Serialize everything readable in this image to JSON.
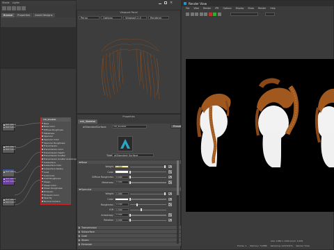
{
  "maya": {
    "top_menu": [
      "Shade",
      "Lights"
    ],
    "tabs": [
      "Browse",
      "Properties",
      "Asset Designs"
    ],
    "viewport_title": "Viewport Panel",
    "viewport_dropdowns": [
      "Persp",
      "Options",
      "Viewport 2.0",
      "Renderer"
    ],
    "hypershade_title": "Hypershade"
  },
  "nodes": [
    {
      "title": "aiStandardHair",
      "ports": [
        "Out Value",
        "Out Color"
      ]
    },
    {
      "title": "aiStandardHair",
      "ports": [
        "Out Value",
        "Out Color"
      ]
    },
    {
      "title": "aiStandardHair",
      "ports": [
        "Out Value",
        "Out Color"
      ]
    },
    {
      "title": "aiStandardHair",
      "ports": [
        "Out Value",
        "Out Color"
      ]
    },
    {
      "title": "aiStandardHair",
      "ports": [
        "Out Value",
        "Out Color"
      ]
    }
  ],
  "main_node": {
    "title": "mtl_Skeletal",
    "ports": [
      "Base",
      "Base Color",
      "Diffuse Roughness",
      "Metalness",
      "Specular",
      "Specular Color",
      "Specular Roughness",
      "Transmission",
      "Transmission Color",
      "Transmission Depth",
      "Transmission Scatter",
      "Transmission Scatter Anisotropy",
      "Subsurface",
      "Subsurface Color",
      "Subsurface Radius",
      "Coat",
      "Coat Color",
      "Coat Roughness",
      "Sheen",
      "Sheen Color",
      "Sheen Roughness",
      "Emission",
      "Emission Color",
      "Opacity",
      "Normal Camera"
    ]
  },
  "attribute_editor": {
    "title": "Properties",
    "tab": "mtl_Skeletal",
    "type_label": "aiStandardSurface:",
    "name_value": "mtl_Skeletal",
    "preset_label": "Presets*",
    "material_type_label": "Type",
    "material_type_value": "aiStandard Surface",
    "sections": {
      "base": "Base",
      "specular": "Specular",
      "transmission": "Transmission",
      "subsurface": "Subsurface",
      "coat": "Coat",
      "sheen": "Sheen",
      "emission": "Emission"
    },
    "base_rows": [
      {
        "label": "Weight",
        "value": "1.000",
        "fill": 0.97,
        "map": true
      },
      {
        "label": "Color",
        "value": "",
        "fill": 0.0,
        "swatch": "#ffffff",
        "map": true
      },
      {
        "label": "Diffuse Roughness",
        "value": "0.000",
        "fill": 0.0,
        "map": true
      },
      {
        "label": "Metalness",
        "value": "0.000",
        "fill": 0.0,
        "map": true
      }
    ],
    "specular_rows": [
      {
        "label": "Weight",
        "value": "1.000",
        "fill": 0.97,
        "map": true
      },
      {
        "label": "Color",
        "value": "",
        "swatch": "#ffffff",
        "map": true
      },
      {
        "label": "Roughness",
        "value": "0.200",
        "fill": 0.2,
        "map": true
      },
      {
        "label": "IOR",
        "value": "1.500",
        "fill": 0.3,
        "map": false
      },
      {
        "label": "Anisotropy",
        "value": "0.000",
        "fill": 0.0,
        "map": true
      },
      {
        "label": "Rotation",
        "value": "0.000",
        "fill": 0.0,
        "map": true
      }
    ]
  },
  "render_view": {
    "title": "Render View",
    "menu": [
      "File",
      "View",
      "Render",
      "IPR",
      "Options",
      "Display",
      "Show",
      "Render",
      "Help"
    ],
    "status": {
      "frame": "Frame: 1",
      "memory": "Memory: 712MB",
      "sampling": "Sampling: [3/3/3/3/3]",
      "render_time": "Render Time:",
      "size": "size: 1960 x 1440 zoom: 0.481"
    }
  },
  "colors": {
    "hair": "#a0581e",
    "node_selected": "#d02020",
    "accent_field": "#fff7a0"
  }
}
